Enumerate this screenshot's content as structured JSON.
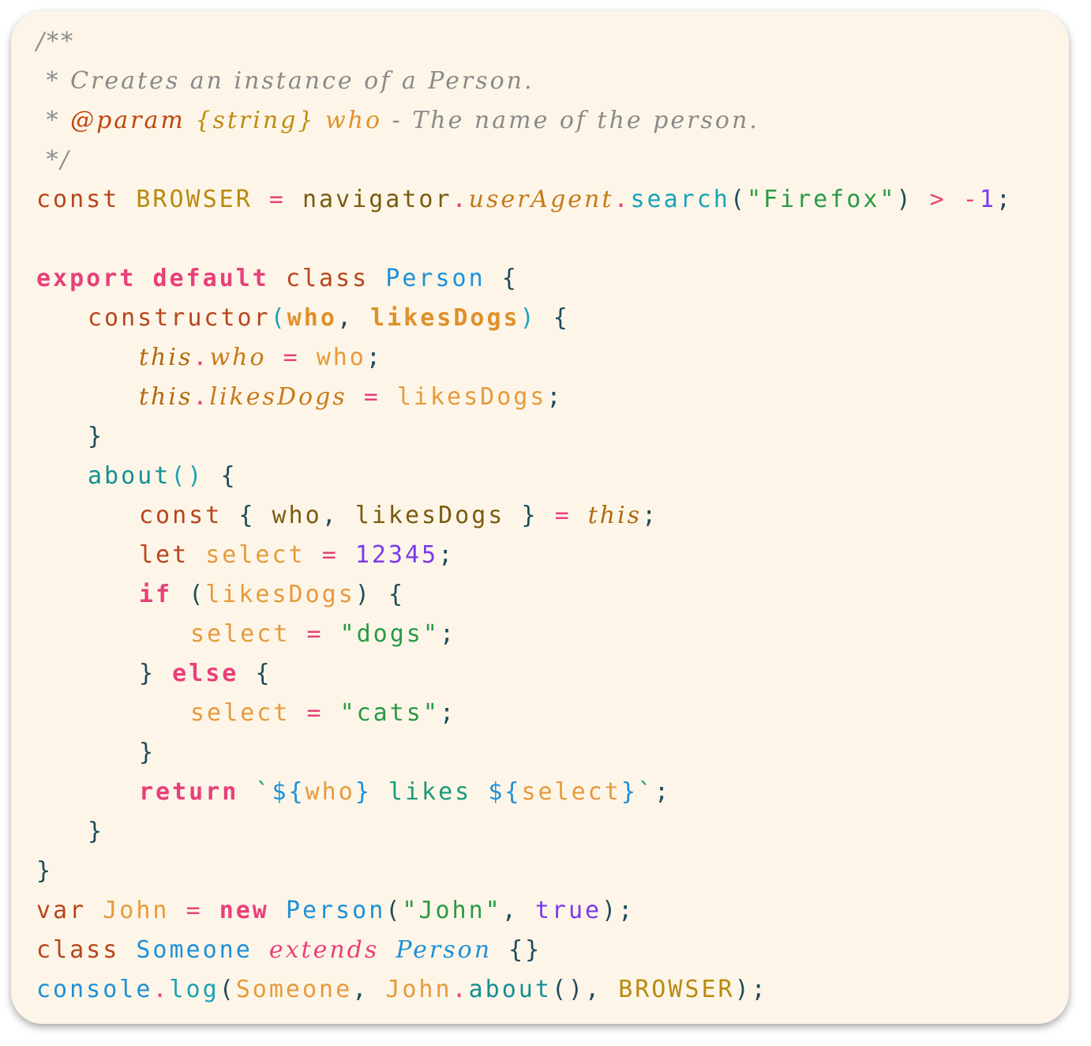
{
  "editor": {
    "background": "#fdf6e8",
    "lines": [
      [
        {
          "t": "/**",
          "c": "cm"
        }
      ],
      [
        {
          "t": " * Creates an instance of a Person.",
          "c": "cm"
        }
      ],
      [
        {
          "t": " * ",
          "c": "cm"
        },
        {
          "t": "@param",
          "c": "tag"
        },
        {
          "t": " {string}",
          "c": "ctype"
        },
        {
          "t": " who",
          "c": "cpar"
        },
        {
          "t": " - The name of the person.",
          "c": "cm"
        }
      ],
      [
        {
          "t": " */",
          "c": "cm"
        }
      ],
      [
        {
          "t": "const",
          "c": "kwd"
        },
        {
          "t": " "
        },
        {
          "t": "BROWSER",
          "c": "cst"
        },
        {
          "t": " "
        },
        {
          "t": "=",
          "c": "op"
        },
        {
          "t": " "
        },
        {
          "t": "navigator",
          "c": "ide"
        },
        {
          "t": ".",
          "c": "op"
        },
        {
          "t": "userAgent",
          "c": "prop"
        },
        {
          "t": ".",
          "c": "op"
        },
        {
          "t": "search",
          "c": "fn"
        },
        {
          "t": "(",
          "c": "pun"
        },
        {
          "t": "\"Firefox\"",
          "c": "str"
        },
        {
          "t": ")",
          "c": "pun"
        },
        {
          "t": " "
        },
        {
          "t": ">",
          "c": "op"
        },
        {
          "t": " "
        },
        {
          "t": "-",
          "c": "op"
        },
        {
          "t": "1",
          "c": "num"
        },
        {
          "t": ";",
          "c": "pun"
        }
      ],
      [],
      [
        {
          "t": "export",
          "c": "kwb"
        },
        {
          "t": " "
        },
        {
          "t": "default",
          "c": "kwb"
        },
        {
          "t": " "
        },
        {
          "t": "class",
          "c": "kwd"
        },
        {
          "t": " "
        },
        {
          "t": "Person",
          "c": "cls"
        },
        {
          "t": " "
        },
        {
          "t": "{",
          "c": "pun"
        }
      ],
      [
        {
          "ind": 1
        },
        {
          "t": "constructor",
          "c": "kwd"
        },
        {
          "t": "(",
          "c": "paren"
        },
        {
          "t": "who",
          "c": "par"
        },
        {
          "t": ", ",
          "c": "pun"
        },
        {
          "t": "likesDogs",
          "c": "par"
        },
        {
          "t": ")",
          "c": "paren"
        },
        {
          "t": " "
        },
        {
          "t": "{",
          "c": "pun"
        }
      ],
      [
        {
          "ind": 2
        },
        {
          "t": "this",
          "c": "thisw"
        },
        {
          "t": ".",
          "c": "op"
        },
        {
          "t": "who",
          "c": "prop"
        },
        {
          "t": " "
        },
        {
          "t": "=",
          "c": "op"
        },
        {
          "t": " "
        },
        {
          "t": "who",
          "c": "var"
        },
        {
          "t": ";",
          "c": "pun"
        }
      ],
      [
        {
          "ind": 2
        },
        {
          "t": "this",
          "c": "thisw"
        },
        {
          "t": ".",
          "c": "op"
        },
        {
          "t": "likesDogs",
          "c": "prop"
        },
        {
          "t": " "
        },
        {
          "t": "=",
          "c": "op"
        },
        {
          "t": " "
        },
        {
          "t": "likesDogs",
          "c": "var"
        },
        {
          "t": ";",
          "c": "pun"
        }
      ],
      [
        {
          "ind": 1
        },
        {
          "t": "}",
          "c": "pun"
        }
      ],
      [
        {
          "ind": 1
        },
        {
          "t": "about",
          "c": "fnd"
        },
        {
          "t": "()",
          "c": "paren"
        },
        {
          "t": " "
        },
        {
          "t": "{",
          "c": "pun"
        }
      ],
      [
        {
          "ind": 2
        },
        {
          "t": "const",
          "c": "kwd"
        },
        {
          "t": " "
        },
        {
          "t": "{",
          "c": "pun"
        },
        {
          "t": " "
        },
        {
          "t": "who",
          "c": "ide"
        },
        {
          "t": ", ",
          "c": "pun"
        },
        {
          "t": "likesDogs",
          "c": "ide"
        },
        {
          "t": " "
        },
        {
          "t": "}",
          "c": "pun"
        },
        {
          "t": " "
        },
        {
          "t": "=",
          "c": "op"
        },
        {
          "t": " "
        },
        {
          "t": "this",
          "c": "thisw"
        },
        {
          "t": ";",
          "c": "pun"
        }
      ],
      [
        {
          "ind": 2
        },
        {
          "t": "let",
          "c": "kwd"
        },
        {
          "t": " "
        },
        {
          "t": "select",
          "c": "var"
        },
        {
          "t": " "
        },
        {
          "t": "=",
          "c": "op"
        },
        {
          "t": " "
        },
        {
          "t": "12345",
          "c": "num"
        },
        {
          "t": ";",
          "c": "pun"
        }
      ],
      [
        {
          "ind": 2
        },
        {
          "t": "if",
          "c": "kwb"
        },
        {
          "t": " "
        },
        {
          "t": "(",
          "c": "pun"
        },
        {
          "t": "likesDogs",
          "c": "var"
        },
        {
          "t": ")",
          "c": "pun"
        },
        {
          "t": " "
        },
        {
          "t": "{",
          "c": "pun"
        }
      ],
      [
        {
          "ind": 3
        },
        {
          "t": "select",
          "c": "var"
        },
        {
          "t": " "
        },
        {
          "t": "=",
          "c": "op"
        },
        {
          "t": " "
        },
        {
          "t": "\"dogs\"",
          "c": "str"
        },
        {
          "t": ";",
          "c": "pun"
        }
      ],
      [
        {
          "ind": 2
        },
        {
          "t": "}",
          "c": "pun"
        },
        {
          "t": " "
        },
        {
          "t": "else",
          "c": "kwb"
        },
        {
          "t": " "
        },
        {
          "t": "{",
          "c": "pun"
        }
      ],
      [
        {
          "ind": 3
        },
        {
          "t": "select",
          "c": "var"
        },
        {
          "t": " "
        },
        {
          "t": "=",
          "c": "op"
        },
        {
          "t": " "
        },
        {
          "t": "\"cats\"",
          "c": "str"
        },
        {
          "t": ";",
          "c": "pun"
        }
      ],
      [
        {
          "ind": 2
        },
        {
          "t": "}",
          "c": "pun"
        }
      ],
      [
        {
          "ind": 2
        },
        {
          "t": "return",
          "c": "kwb"
        },
        {
          "t": " "
        },
        {
          "t": "`",
          "c": "tpl"
        },
        {
          "t": "${",
          "c": "tpld"
        },
        {
          "t": "who",
          "c": "var"
        },
        {
          "t": "}",
          "c": "tpld"
        },
        {
          "t": " likes ",
          "c": "tpl"
        },
        {
          "t": "${",
          "c": "tpld"
        },
        {
          "t": "select",
          "c": "var"
        },
        {
          "t": "}",
          "c": "tpld"
        },
        {
          "t": "`",
          "c": "tpl"
        },
        {
          "t": ";",
          "c": "pun"
        }
      ],
      [
        {
          "ind": 1
        },
        {
          "t": "}",
          "c": "pun"
        }
      ],
      [
        {
          "t": "}",
          "c": "pun"
        }
      ],
      [
        {
          "t": "var",
          "c": "kwd"
        },
        {
          "t": " "
        },
        {
          "t": "John",
          "c": "var"
        },
        {
          "t": " "
        },
        {
          "t": "=",
          "c": "op"
        },
        {
          "t": " "
        },
        {
          "t": "new",
          "c": "kwb"
        },
        {
          "t": " "
        },
        {
          "t": "Person",
          "c": "cls"
        },
        {
          "t": "(",
          "c": "pun"
        },
        {
          "t": "\"John\"",
          "c": "str"
        },
        {
          "t": ", ",
          "c": "pun"
        },
        {
          "t": "true",
          "c": "bool"
        },
        {
          "t": ");",
          "c": "pun"
        }
      ],
      [
        {
          "t": "class",
          "c": "kwd"
        },
        {
          "t": " "
        },
        {
          "t": "Someone",
          "c": "cls"
        },
        {
          "t": " "
        },
        {
          "t": "extends",
          "c": "ext"
        },
        {
          "t": " "
        },
        {
          "t": "Person",
          "c": "clsi"
        },
        {
          "t": " "
        },
        {
          "t": "{}",
          "c": "pun"
        }
      ],
      [
        {
          "t": "console",
          "c": "cls"
        },
        {
          "t": ".",
          "c": "op"
        },
        {
          "t": "log",
          "c": "fn"
        },
        {
          "t": "(",
          "c": "pun"
        },
        {
          "t": "Someone",
          "c": "var"
        },
        {
          "t": ", ",
          "c": "pun"
        },
        {
          "t": "John",
          "c": "var"
        },
        {
          "t": ".",
          "c": "op"
        },
        {
          "t": "about",
          "c": "fnd"
        },
        {
          "t": "()",
          "c": "pun"
        },
        {
          "t": ", ",
          "c": "pun"
        },
        {
          "t": "BROWSER",
          "c": "cst"
        },
        {
          "t": ");",
          "c": "pun"
        }
      ]
    ]
  }
}
